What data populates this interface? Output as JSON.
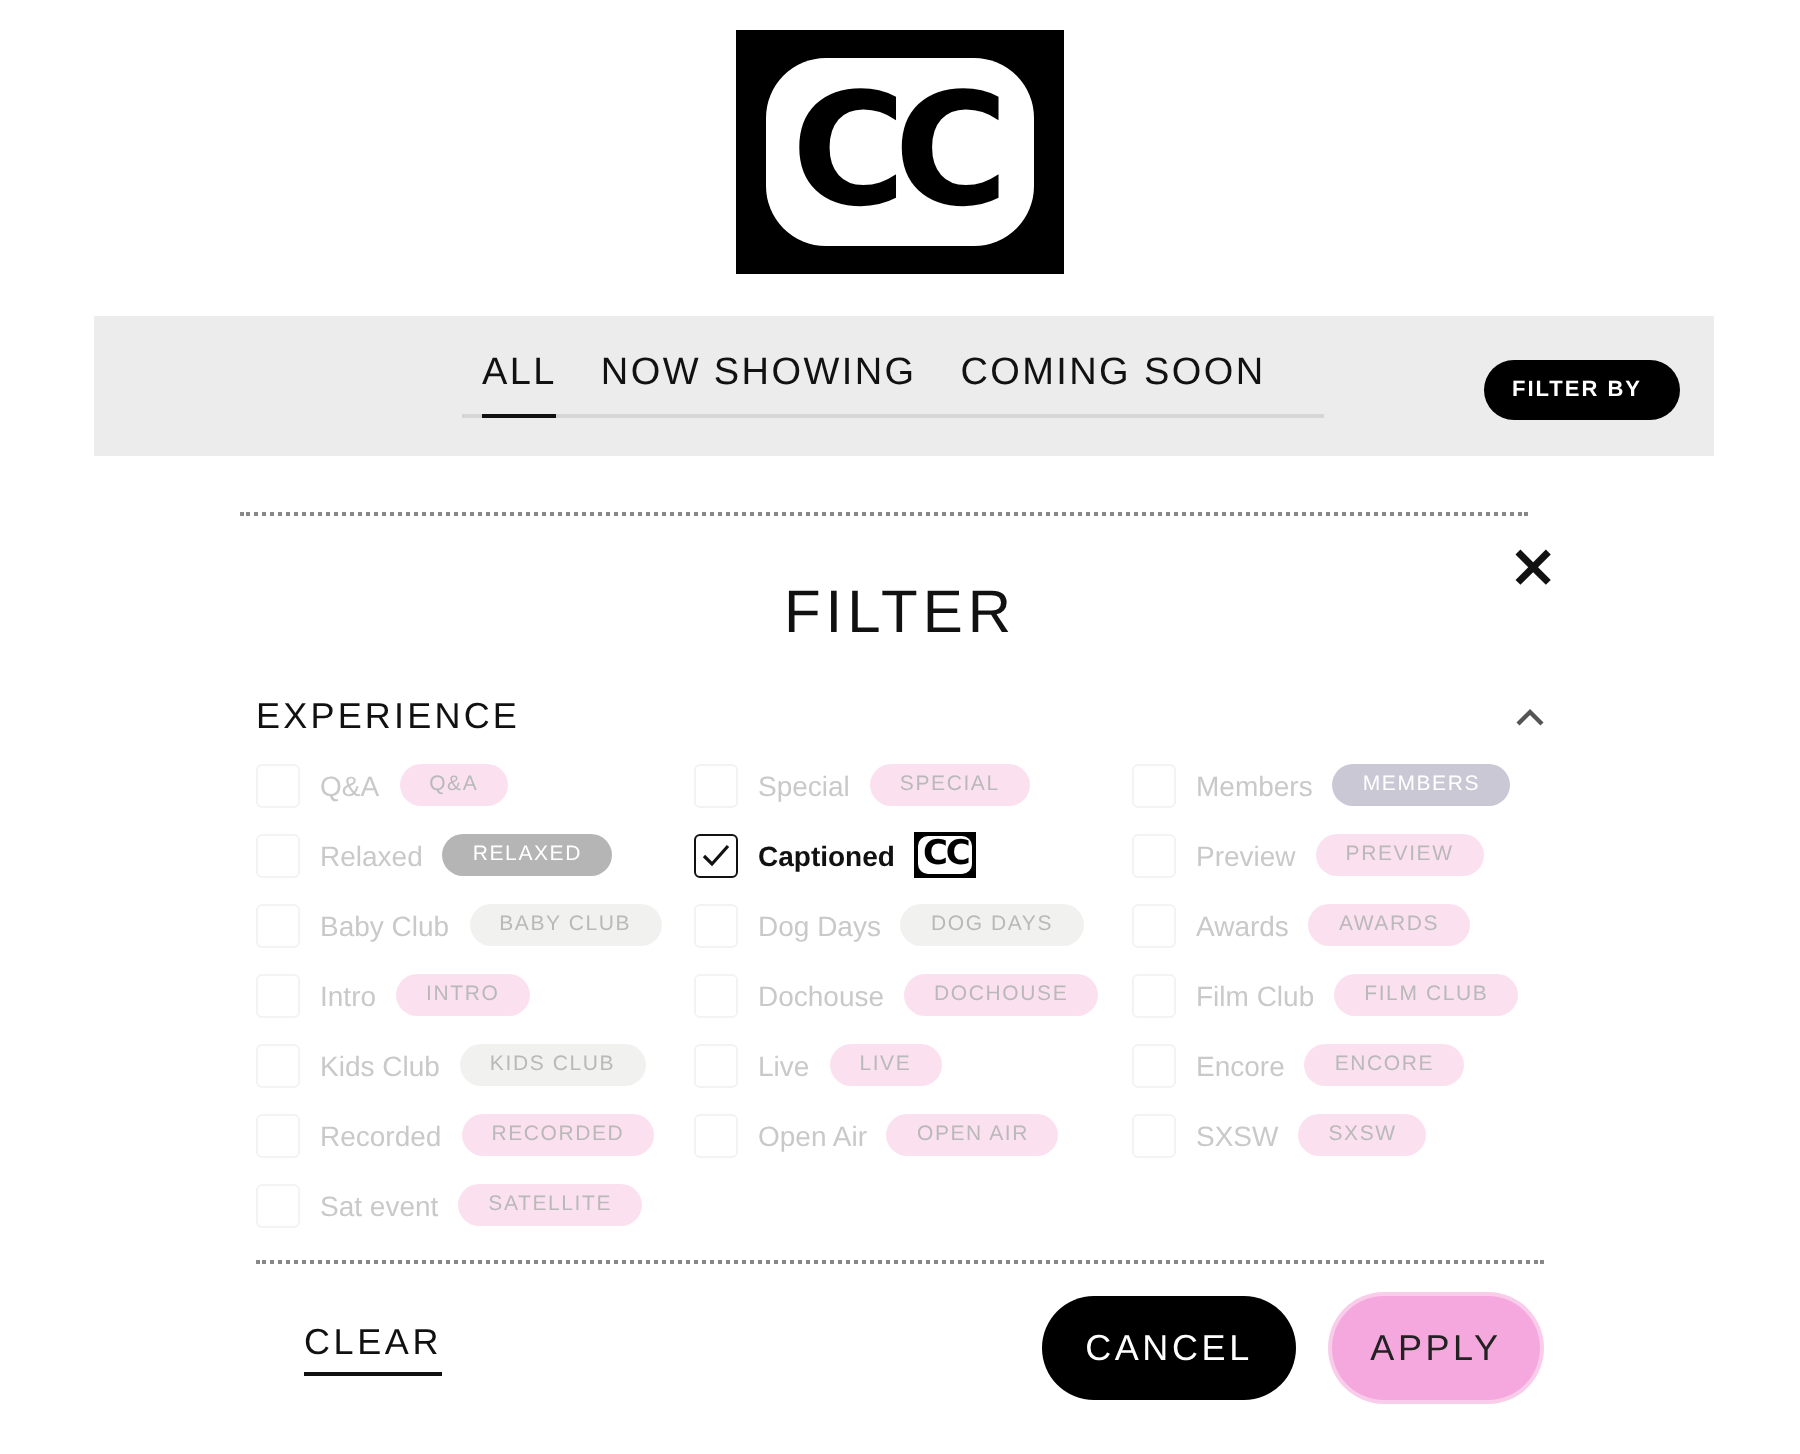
{
  "logo": {
    "text": "CC"
  },
  "tabs": [
    {
      "label": "ALL",
      "selected": true
    },
    {
      "label": "NOW SHOWING",
      "selected": false
    },
    {
      "label": "COMING SOON",
      "selected": false
    }
  ],
  "filter_button": "FILTER BY",
  "filter": {
    "title": "FILTER",
    "close": "×",
    "section": {
      "title": "EXPERIENCE",
      "expanded": true,
      "columns": [
        [
          {
            "label": "Q&A",
            "checked": false,
            "kind": "tag",
            "tag": "Q&A",
            "color": "#fbe1f0"
          },
          {
            "label": "Relaxed",
            "checked": false,
            "kind": "tag",
            "tag": "RELAXED",
            "color": "#b5b5b5"
          },
          {
            "label": "Baby Club",
            "checked": false,
            "kind": "tag",
            "tag": "BABY CLUB",
            "color": "#f1f1ef"
          },
          {
            "label": "Intro",
            "checked": false,
            "kind": "tag",
            "tag": "INTRO",
            "color": "#fbe1f0"
          },
          {
            "label": "Kids Club",
            "checked": false,
            "kind": "tag",
            "tag": "KIDS CLUB",
            "color": "#f1f1ef"
          },
          {
            "label": "Recorded",
            "checked": false,
            "kind": "tag",
            "tag": "RECORDED",
            "color": "#fbe1f0"
          },
          {
            "label": "Sat event",
            "checked": false,
            "kind": "tag",
            "tag": "SATELLITE",
            "color": "#fbe1f0"
          }
        ],
        [
          {
            "label": "Special",
            "checked": false,
            "kind": "tag",
            "tag": "SPECIAL",
            "color": "#fbe1f0"
          },
          {
            "label": "Captioned",
            "checked": true,
            "kind": "logo",
            "tag": "CC"
          },
          {
            "label": "Dog Days",
            "checked": false,
            "kind": "tag",
            "tag": "DOG DAYS",
            "color": "#f1f1ef"
          },
          {
            "label": "Dochouse",
            "checked": false,
            "kind": "tag",
            "tag": "DOCHOUSE",
            "color": "#fbe1f0"
          },
          {
            "label": "Live",
            "checked": false,
            "kind": "tag",
            "tag": "LIVE",
            "color": "#fbe1f0"
          },
          {
            "label": "Open Air",
            "checked": false,
            "kind": "tag",
            "tag": "OPEN AIR",
            "color": "#fbe1f0"
          }
        ],
        [
          {
            "label": "Members",
            "checked": false,
            "kind": "tag",
            "tag": "MEMBERS",
            "color": "#cbc8d5"
          },
          {
            "label": "Preview",
            "checked": false,
            "kind": "tag",
            "tag": "PREVIEW",
            "color": "#fbe1f0"
          },
          {
            "label": "Awards",
            "checked": false,
            "kind": "tag",
            "tag": "AWARDS",
            "color": "#fbe1f0"
          },
          {
            "label": "Film Club",
            "checked": false,
            "kind": "tag",
            "tag": "FILM CLUB",
            "color": "#fbe1f0"
          },
          {
            "label": "Encore",
            "checked": false,
            "kind": "tag",
            "tag": "ENCORE",
            "color": "#fbe1f0"
          },
          {
            "label": "SXSW",
            "checked": false,
            "kind": "tag",
            "tag": "SXSW",
            "color": "#fbe1f0"
          }
        ]
      ]
    },
    "buttons": [
      {
        "label": "CLEAR",
        "kind": "link"
      },
      {
        "label": "CANCEL",
        "kind": "dark"
      },
      {
        "label": "APPLY",
        "kind": "pink"
      }
    ]
  }
}
